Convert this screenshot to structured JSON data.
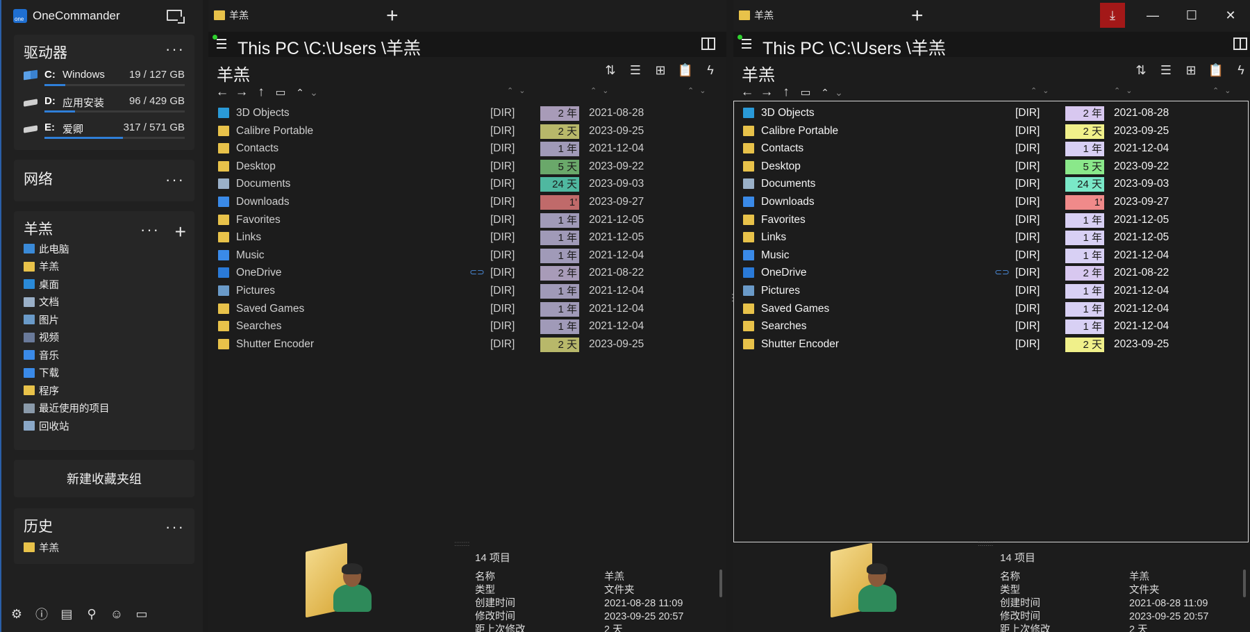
{
  "app": {
    "title": "OneCommander",
    "logo_text": "one"
  },
  "colors": {
    "accent": "#2f7fd8",
    "download_button": "#a31818",
    "age_2y": "#a89bb8",
    "age_2d": "#b8b86a",
    "age_1y": "#a09ab8",
    "age_5d": "#6aa86a",
    "age_24d": "#4fb8a0",
    "age_1h": "#c06a6a"
  },
  "drives": {
    "title": "驱动器",
    "items": [
      {
        "letter": "C:",
        "name": "Windows",
        "size": "19 / 127 GB",
        "used": 0.15,
        "icon": "windows-drive-icon"
      },
      {
        "letter": "D:",
        "name": "应用安装",
        "size": "96 / 429 GB",
        "used": 0.22,
        "icon": "hdd-icon"
      },
      {
        "letter": "E:",
        "name": "爱卿",
        "size": "317 / 571 GB",
        "used": 0.56,
        "icon": "hdd-icon"
      }
    ]
  },
  "network": {
    "title": "网络"
  },
  "favorites": {
    "title": "羊羔",
    "items": [
      {
        "label": "此电脑",
        "icon": "computer-icon",
        "color": "#3a8ad8"
      },
      {
        "label": "羊羔",
        "icon": "user-folder-icon",
        "color": "#e8c24a"
      },
      {
        "label": "桌面",
        "icon": "desktop-icon",
        "color": "#2a8ad8"
      },
      {
        "label": "文档",
        "icon": "documents-icon",
        "color": "#9ab0c8"
      },
      {
        "label": "图片",
        "icon": "pictures-icon",
        "color": "#6a9ac8"
      },
      {
        "label": "视频",
        "icon": "videos-icon",
        "color": "#6a7a9a"
      },
      {
        "label": "音乐",
        "icon": "music-icon",
        "color": "#3a8ae8"
      },
      {
        "label": "下载",
        "icon": "download-icon",
        "color": "#3a8ae8"
      },
      {
        "label": "程序",
        "icon": "folder-icon",
        "color": "#e8c24a"
      },
      {
        "label": "最近使用的项目",
        "icon": "recent-icon",
        "color": "#8a9aaa"
      },
      {
        "label": "回收站",
        "icon": "recycle-bin-icon",
        "color": "#8aa8c8"
      }
    ]
  },
  "new_group_button": "新建收藏夹组",
  "history": {
    "title": "历史",
    "items": [
      {
        "label": "羊羔"
      }
    ]
  },
  "panes": [
    {
      "tab_label": "羊羔",
      "path": "This PC \\C:\\Users \\羊羔",
      "folder_title": "羊羔",
      "dir_label": "[DIR]",
      "files": [
        {
          "name": "3D Objects",
          "age": "2 年",
          "date": "2021-08-28",
          "icon": "3d-objects-icon",
          "color": "#2a9ad8"
        },
        {
          "name": "Calibre Portable",
          "age": "2 天",
          "date": "2023-09-25",
          "icon": "folder-icon",
          "color": "#e8c24a"
        },
        {
          "name": "Contacts",
          "age": "1 年",
          "date": "2021-12-04",
          "icon": "contacts-icon",
          "color": "#e8c24a"
        },
        {
          "name": "Desktop",
          "age": "5 天",
          "date": "2023-09-22",
          "icon": "folder-icon",
          "color": "#e8c24a"
        },
        {
          "name": "Documents",
          "age": "24 天",
          "date": "2023-09-03",
          "icon": "documents-icon",
          "color": "#9ab0c8"
        },
        {
          "name": "Downloads",
          "age": "1'",
          "date": "2023-09-27",
          "icon": "download-icon",
          "color": "#3a8ae8"
        },
        {
          "name": "Favorites",
          "age": "1 年",
          "date": "2021-12-05",
          "icon": "favorites-icon",
          "color": "#e8c24a"
        },
        {
          "name": "Links",
          "age": "1 年",
          "date": "2021-12-05",
          "icon": "links-icon",
          "color": "#e8c24a"
        },
        {
          "name": "Music",
          "age": "1 年",
          "date": "2021-12-04",
          "icon": "music-icon",
          "color": "#3a8ae8"
        },
        {
          "name": "OneDrive",
          "age": "2 年",
          "date": "2021-08-22",
          "icon": "onedrive-icon",
          "color": "#2a7ad8",
          "linked": true
        },
        {
          "name": "Pictures",
          "age": "1 年",
          "date": "2021-12-04",
          "icon": "pictures-icon",
          "color": "#6a9ac8"
        },
        {
          "name": "Saved Games",
          "age": "1 年",
          "date": "2021-12-04",
          "icon": "saved-games-icon",
          "color": "#e8c24a"
        },
        {
          "name": "Searches",
          "age": "1 年",
          "date": "2021-12-04",
          "icon": "searches-icon",
          "color": "#e8c24a"
        },
        {
          "name": "Shutter Encoder",
          "age": "2 天",
          "date": "2023-09-25",
          "icon": "folder-icon",
          "color": "#e8c24a"
        }
      ],
      "details": {
        "count": "14 项目",
        "rows": [
          {
            "label": "名称",
            "value": "羊羔"
          },
          {
            "label": "类型",
            "value": "文件夹"
          },
          {
            "label": "创建时间",
            "value": "2021-08-28  11:09"
          },
          {
            "label": "修改时间",
            "value": "2023-09-25  20:57"
          },
          {
            "label": "距上次修改",
            "value": "2 天"
          }
        ]
      }
    },
    {
      "tab_label": "羊羔",
      "path": "This PC \\C:\\Users \\羊羔",
      "folder_title": "羊羔",
      "dir_label": "[DIR]",
      "files": [
        {
          "name": "3D Objects",
          "age": "2 年",
          "date": "2021-08-28",
          "icon": "3d-objects-icon",
          "color": "#2a9ad8"
        },
        {
          "name": "Calibre Portable",
          "age": "2 天",
          "date": "2023-09-25",
          "icon": "folder-icon",
          "color": "#e8c24a"
        },
        {
          "name": "Contacts",
          "age": "1 年",
          "date": "2021-12-04",
          "icon": "contacts-icon",
          "color": "#e8c24a"
        },
        {
          "name": "Desktop",
          "age": "5 天",
          "date": "2023-09-22",
          "icon": "folder-icon",
          "color": "#e8c24a"
        },
        {
          "name": "Documents",
          "age": "24 天",
          "date": "2023-09-03",
          "icon": "documents-icon",
          "color": "#9ab0c8"
        },
        {
          "name": "Downloads",
          "age": "1'",
          "date": "2023-09-27",
          "icon": "download-icon",
          "color": "#3a8ae8"
        },
        {
          "name": "Favorites",
          "age": "1 年",
          "date": "2021-12-05",
          "icon": "favorites-icon",
          "color": "#e8c24a"
        },
        {
          "name": "Links",
          "age": "1 年",
          "date": "2021-12-05",
          "icon": "links-icon",
          "color": "#e8c24a"
        },
        {
          "name": "Music",
          "age": "1 年",
          "date": "2021-12-04",
          "icon": "music-icon",
          "color": "#3a8ae8"
        },
        {
          "name": "OneDrive",
          "age": "2 年",
          "date": "2021-08-22",
          "icon": "onedrive-icon",
          "color": "#2a7ad8",
          "linked": true
        },
        {
          "name": "Pictures",
          "age": "1 年",
          "date": "2021-12-04",
          "icon": "pictures-icon",
          "color": "#6a9ac8"
        },
        {
          "name": "Saved Games",
          "age": "1 年",
          "date": "2021-12-04",
          "icon": "saved-games-icon",
          "color": "#e8c24a"
        },
        {
          "name": "Searches",
          "age": "1 年",
          "date": "2021-12-04",
          "icon": "searches-icon",
          "color": "#e8c24a"
        },
        {
          "name": "Shutter Encoder",
          "age": "2 天",
          "date": "2023-09-25",
          "icon": "folder-icon",
          "color": "#e8c24a"
        }
      ],
      "details": {
        "count": "14 项目",
        "rows": [
          {
            "label": "名称",
            "value": "羊羔"
          },
          {
            "label": "类型",
            "value": "文件夹"
          },
          {
            "label": "创建时间",
            "value": "2021-08-28  11:09"
          },
          {
            "label": "修改时间",
            "value": "2023-09-25  20:57"
          },
          {
            "label": "距上次修改",
            "value": "2 天"
          }
        ]
      }
    }
  ]
}
